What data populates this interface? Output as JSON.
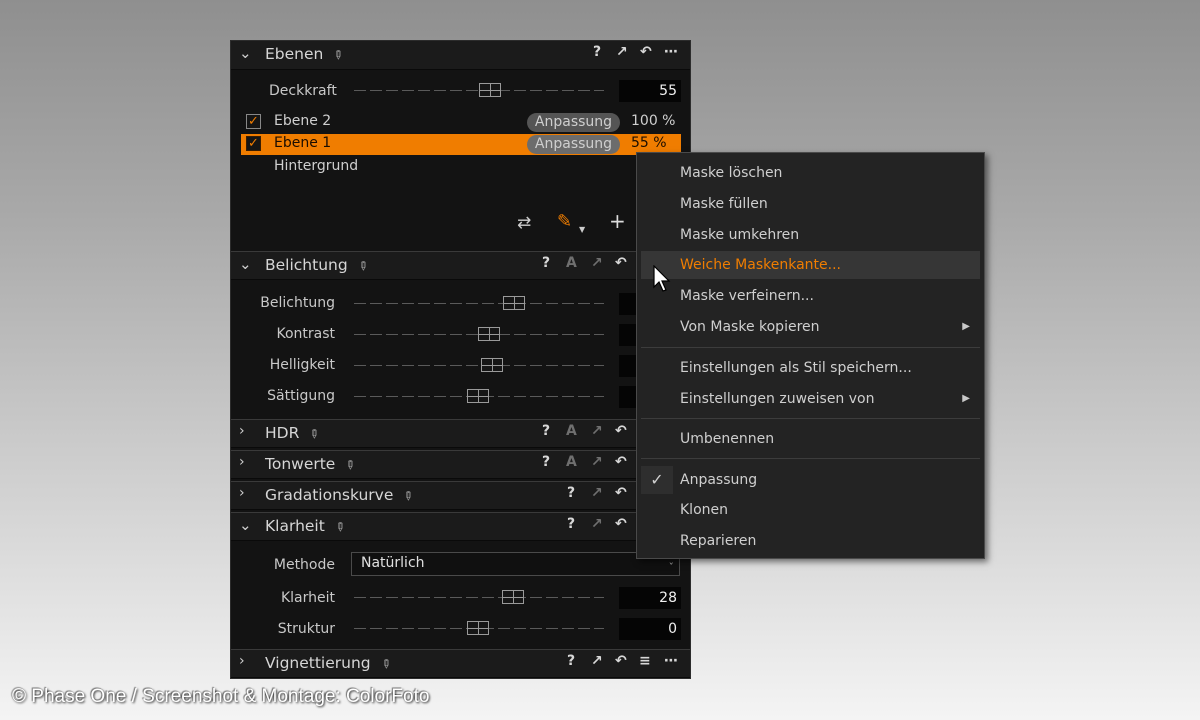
{
  "layers_panel": {
    "title": "Ebenen",
    "opacity_label": "Deckkraft",
    "opacity_value": "55",
    "opacity_level_percent": 55,
    "layers": [
      {
        "name": "Ebene 2",
        "checked": true,
        "mode": "Anpassung",
        "opacity": "100 %"
      },
      {
        "name": "Ebene 1",
        "checked": true,
        "mode": "Anpassung",
        "opacity": "55 %",
        "selected": true
      },
      {
        "name": "Hintergrund"
      }
    ]
  },
  "sections": {
    "belichtung": {
      "title": "Belichtung",
      "sliders": [
        {
          "label": "Belichtung"
        },
        {
          "label": "Kontrast"
        },
        {
          "label": "Helligkeit"
        },
        {
          "label": "Sättigung"
        }
      ]
    },
    "hdr": {
      "title": "HDR"
    },
    "tonwerte": {
      "title": "Tonwerte"
    },
    "gradation": {
      "title": "Gradationskurve"
    },
    "klarheit": {
      "title": "Klarheit",
      "method_label": "Methode",
      "method_value": "Natürlich",
      "sliders": [
        {
          "label": "Klarheit",
          "value": "28"
        },
        {
          "label": "Struktur",
          "value": "0"
        }
      ]
    },
    "vignette": {
      "title": "Vignettierung"
    }
  },
  "header_icons": {
    "help": "?",
    "auto": "A"
  },
  "context_menu": {
    "items": [
      "Maske löschen",
      "Maske füllen",
      "Maske umkehren",
      "Weiche Maskenkante...",
      "Maske verfeinern...",
      "Von Maske kopieren",
      "Einstellungen als Stil speichern...",
      "Einstellungen zuweisen von",
      "Umbenennen",
      "Anpassung",
      "Klonen",
      "Reparieren"
    ],
    "highlighted_index": 3,
    "checked_item": "Anpassung"
  },
  "credit": "© Phase One / Screenshot & Montage: ColorFoto",
  "colors": {
    "accent": "#f07d00",
    "panel_bg": "#131313",
    "menu_bg": "#232323"
  }
}
